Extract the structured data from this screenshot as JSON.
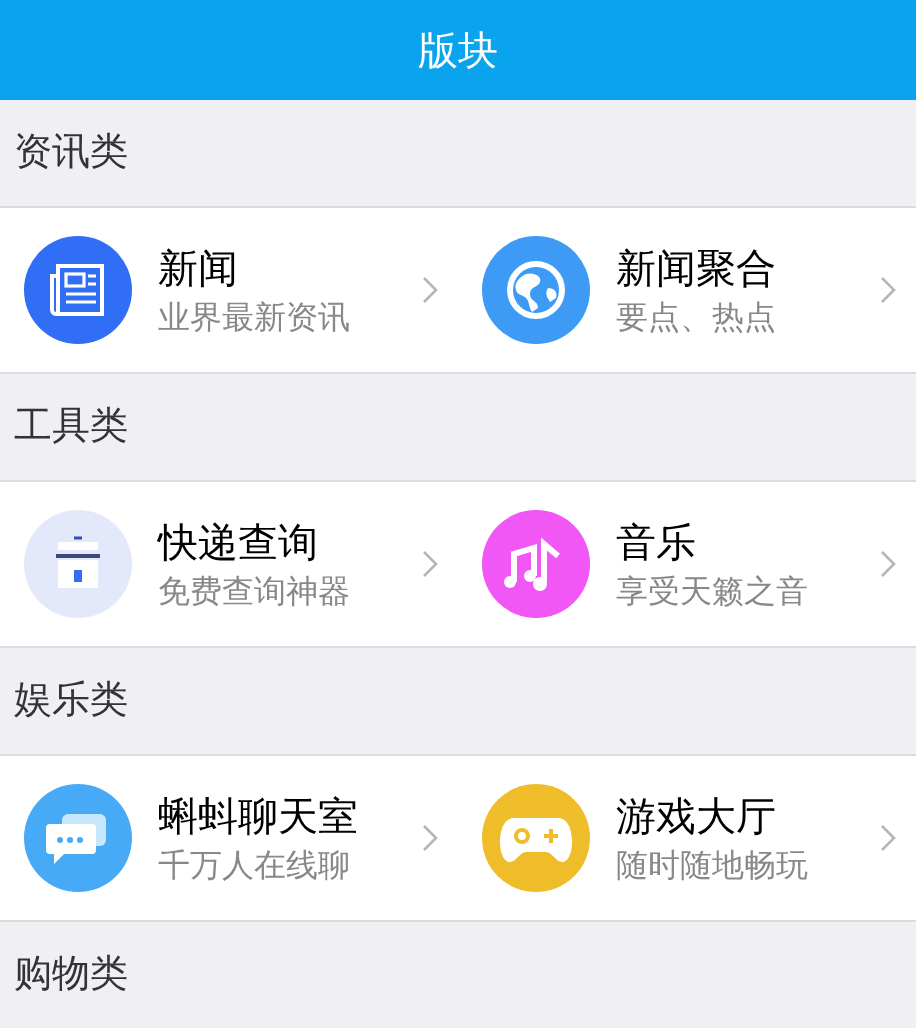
{
  "header": {
    "title": "版块"
  },
  "sections": [
    {
      "title": "资讯类",
      "items": [
        {
          "color": "#2f6ef5",
          "title": "新闻",
          "subtitle": "业界最新资讯"
        },
        {
          "color": "#3d9bf6",
          "title": "新闻聚合",
          "subtitle": "要点、热点"
        }
      ]
    },
    {
      "title": "工具类",
      "items": [
        {
          "color": "#e3e8fb",
          "title": "快递查询",
          "subtitle": "免费查询神器"
        },
        {
          "color": "#f157f5",
          "title": "音乐",
          "subtitle": "享受天籁之音"
        }
      ]
    },
    {
      "title": "娱乐类",
      "items": [
        {
          "color": "#47aaf6",
          "title": "蝌蚪聊天室",
          "subtitle": "千万人在线聊"
        },
        {
          "color": "#efbd2a",
          "title": "游戏大厅",
          "subtitle": "随时随地畅玩"
        }
      ]
    },
    {
      "title": "购物类"
    }
  ]
}
